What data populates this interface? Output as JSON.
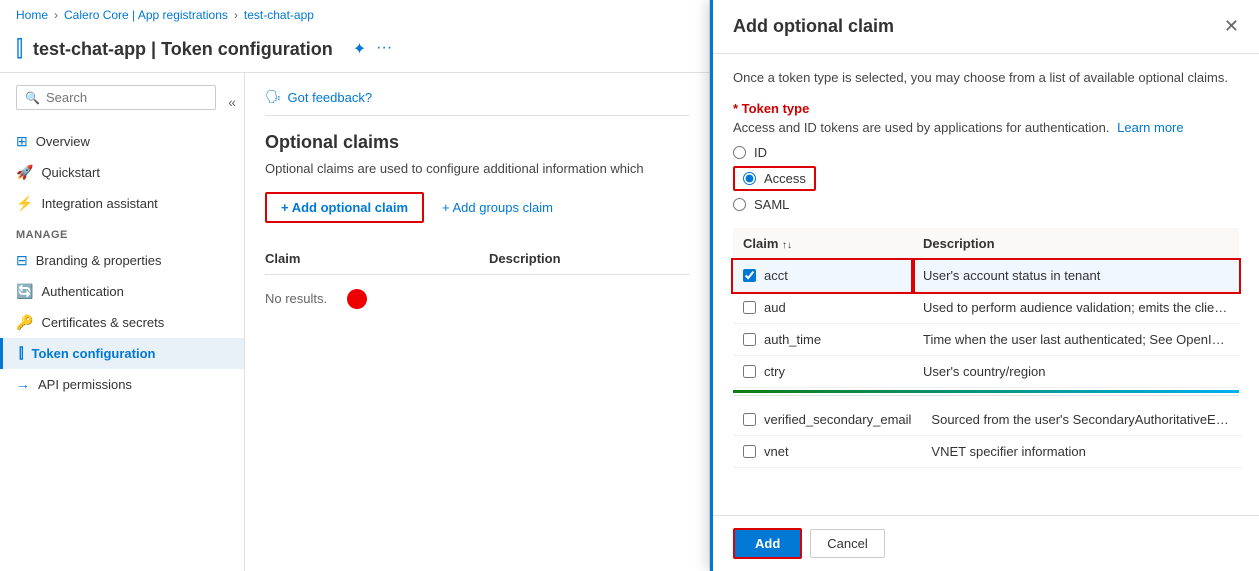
{
  "breadcrumb": {
    "home": "Home",
    "app_registrations": "Calero Core | App registrations",
    "app_name": "test-chat-app"
  },
  "app_header": {
    "title": "test-chat-app | Token configuration",
    "icon": "|||",
    "pin_icon": "✦",
    "more_icon": "···"
  },
  "sidebar": {
    "search_placeholder": "Search",
    "chevron_label": "«",
    "nav_items": [
      {
        "id": "overview",
        "label": "Overview",
        "icon": "⊞"
      },
      {
        "id": "quickstart",
        "label": "Quickstart",
        "icon": "🚀"
      },
      {
        "id": "integration",
        "label": "Integration assistant",
        "icon": "⚡"
      }
    ],
    "manage_label": "Manage",
    "manage_items": [
      {
        "id": "branding",
        "label": "Branding & properties",
        "icon": "⊟"
      },
      {
        "id": "authentication",
        "label": "Authentication",
        "icon": "🔄"
      },
      {
        "id": "certificates",
        "label": "Certificates & secrets",
        "icon": "🔑"
      },
      {
        "id": "token-config",
        "label": "Token configuration",
        "icon": "|||",
        "active": true
      },
      {
        "id": "api-permissions",
        "label": "API permissions",
        "icon": "→"
      }
    ]
  },
  "content": {
    "feedback_text": "Got feedback?",
    "title": "Optional claims",
    "description": "Optional claims are used to configure additional information which",
    "add_claim_label": "+ Add optional claim",
    "add_groups_label": "+ Add groups claim",
    "table": {
      "col_claim": "Claim",
      "col_description": "Description"
    },
    "no_results": "No results."
  },
  "dialog": {
    "title": "Add optional claim",
    "close_label": "✕",
    "intro": "Once a token type is selected, you may choose from a list of available optional claims.",
    "token_type_label": "* Token type",
    "token_type_desc": "Access and ID tokens are used by applications for authentication.",
    "learn_more": "Learn more",
    "radio_options": [
      {
        "id": "id",
        "label": "ID"
      },
      {
        "id": "access",
        "label": "Access",
        "selected": true
      },
      {
        "id": "saml",
        "label": "SAML"
      }
    ],
    "table": {
      "col_claim": "Claim",
      "col_description": "Description",
      "rows": [
        {
          "id": "acct",
          "label": "acct",
          "description": "User's account status in tenant",
          "checked": true,
          "selected": true
        },
        {
          "id": "aud",
          "label": "aud",
          "description": "Used to perform audience validation; emits the client ID...",
          "checked": false
        },
        {
          "id": "auth_time",
          "label": "auth_time",
          "description": "Time when the user last authenticated; See OpenID Con...",
          "checked": false
        },
        {
          "id": "ctry",
          "label": "ctry",
          "description": "User's country/region",
          "checked": false
        }
      ],
      "bottom_rows": [
        {
          "id": "verified_secondary_email",
          "label": "verified_secondary_email",
          "description": "Sourced from the user's SecondaryAuthoritativeEmail",
          "checked": false
        },
        {
          "id": "vnet",
          "label": "vnet",
          "description": "VNET specifier information",
          "checked": false
        }
      ]
    },
    "add_button": "Add",
    "cancel_button": "Cancel"
  }
}
